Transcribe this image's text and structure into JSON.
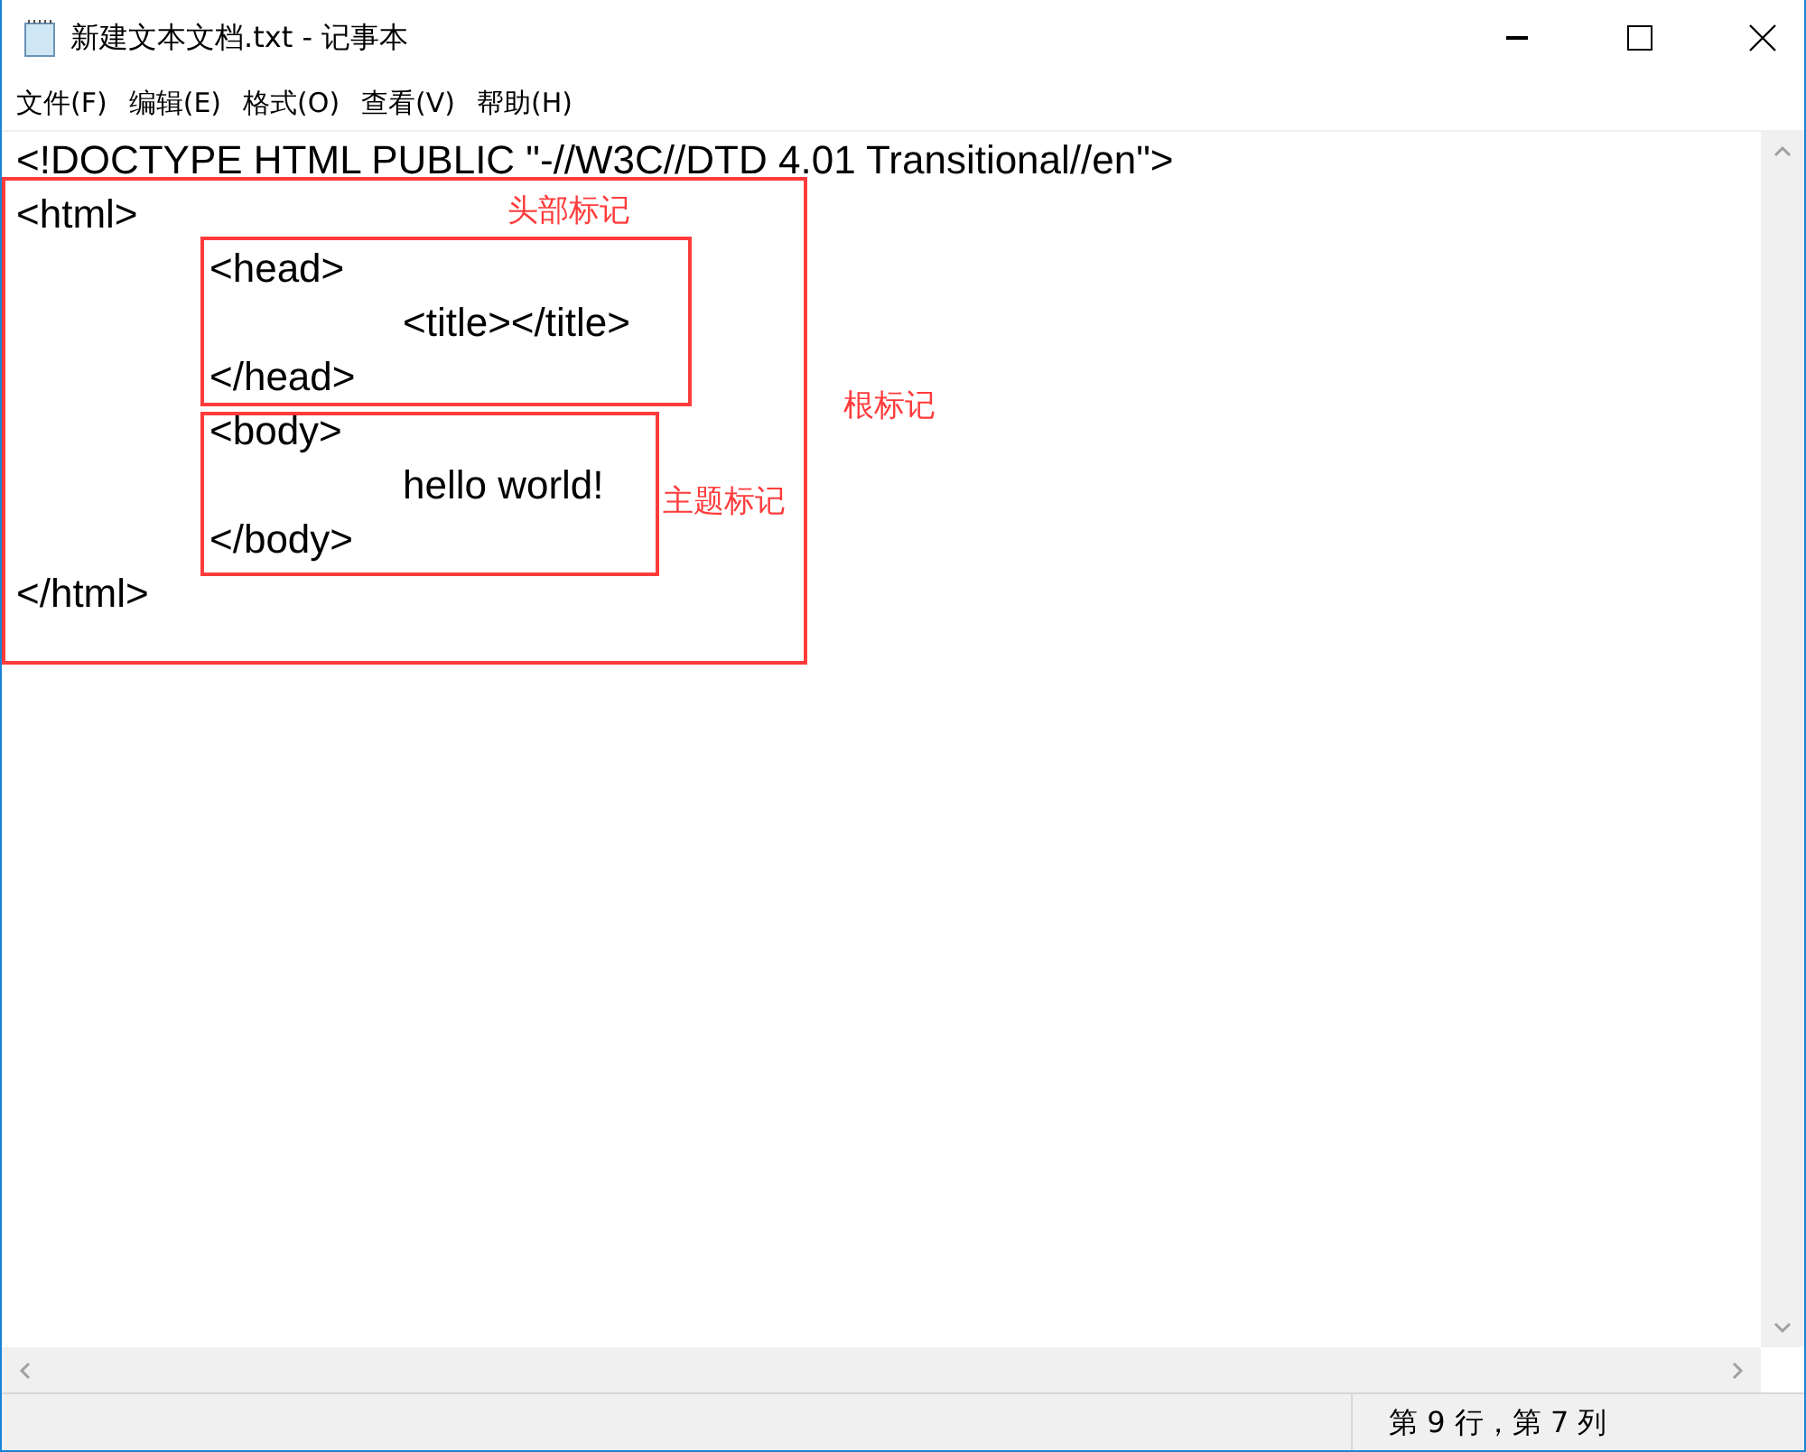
{
  "window": {
    "title": "新建文本文档.txt - 记事本"
  },
  "menu": [
    "文件(F)",
    "编辑(E)",
    "格式(O)",
    "查看(V)",
    "帮助(H)"
  ],
  "lines": [
    "<!DOCTYPE HTML PUBLIC \"-//W3C//DTD 4.01 Transitional//en\">",
    "<html>",
    "\t<head>",
    "\t\t<title></title>",
    "\t</head>",
    "\t<body>",
    "\t\thello world!",
    "\t</body>",
    "</html>"
  ],
  "annotations": [
    {
      "kind": "root",
      "label": "根标记"
    },
    {
      "kind": "head",
      "label": "头部标记"
    },
    {
      "kind": "body",
      "label": "主题标记"
    }
  ],
  "status_bar": {
    "position": "第 9 行，第 7 列"
  }
}
